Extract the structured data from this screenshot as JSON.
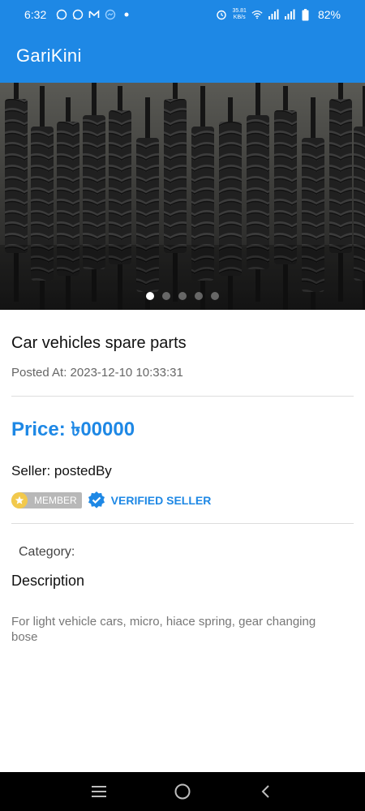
{
  "status_bar": {
    "time": "6:32",
    "net_speed_value": "35.81",
    "net_speed_unit": "KB/s",
    "battery": "82%"
  },
  "app_bar": {
    "title": "GariKini"
  },
  "carousel": {
    "slide_count": 5,
    "active_index": 0
  },
  "listing": {
    "title": "Car vehicles spare parts",
    "posted_at": "Posted At: 2023-12-10 10:33:31",
    "price": "Price: ৳00000",
    "seller": "Seller: postedBy",
    "member_badge": "MEMBER",
    "verified_label": "VERIFIED SELLER",
    "category": "Category:",
    "description_heading": "Description",
    "description": "For light vehicle cars, micro,  hiace spring,  gear changing bose"
  },
  "colors": {
    "primary": "#1e88e5",
    "member_badge_bg": "#b8b8b8",
    "member_star": "#f2c94c"
  }
}
